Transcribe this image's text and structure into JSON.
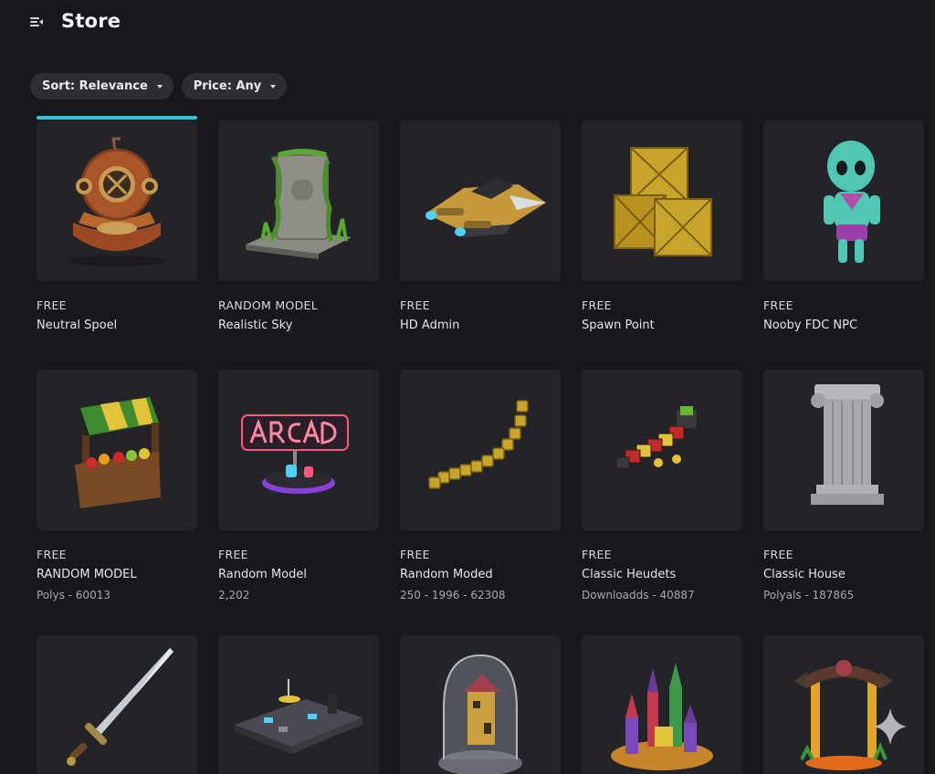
{
  "header": {
    "title": "Store",
    "menu_icon": "menu-collapse-icon"
  },
  "filters": [
    {
      "label": "Sort: Relevance"
    },
    {
      "label": "Price: Any"
    }
  ],
  "items": [
    {
      "price": "FREE",
      "name": "Neutral Spoel",
      "meta": "",
      "icon": "diving-helmet"
    },
    {
      "price": "RANDOM MODEL",
      "name": "Realistic Sky",
      "meta": "",
      "icon": "overgrown-ruin"
    },
    {
      "price": "FREE",
      "name": "HD Admin",
      "meta": "",
      "icon": "spaceship"
    },
    {
      "price": "FREE",
      "name": "Spawn Point",
      "meta": "",
      "icon": "crates"
    },
    {
      "price": "FREE",
      "name": "Nooby FDC NPC",
      "meta": "",
      "icon": "alien-npc"
    },
    {
      "price": "FREE",
      "name": "RANDOM MODEL",
      "meta": "Polys - 60013",
      "icon": "market-stall"
    },
    {
      "price": "FREE",
      "name": "Random Model",
      "meta": "2,202",
      "icon": "arcade-sign"
    },
    {
      "price": "FREE",
      "name": "Random Moded",
      "meta": "250 - 1996 - 62308",
      "icon": "gold-chain"
    },
    {
      "price": "FREE",
      "name": "Classic Heudets",
      "meta": "Downloadds - 40887",
      "icon": "block-caterpillar"
    },
    {
      "price": "FREE",
      "name": "Classic House",
      "meta": "Polyals - 187865",
      "icon": "greek-column"
    },
    {
      "price": "",
      "name": "",
      "meta": "",
      "icon": "sword"
    },
    {
      "price": "",
      "name": "",
      "meta": "",
      "icon": "city-plate"
    },
    {
      "price": "",
      "name": "",
      "meta": "",
      "icon": "house-dome"
    },
    {
      "price": "",
      "name": "",
      "meta": "",
      "icon": "fantasy-village"
    },
    {
      "price": "",
      "name": "",
      "meta": "",
      "icon": "portal-gate"
    }
  ],
  "accent_color": "#2bc6da"
}
